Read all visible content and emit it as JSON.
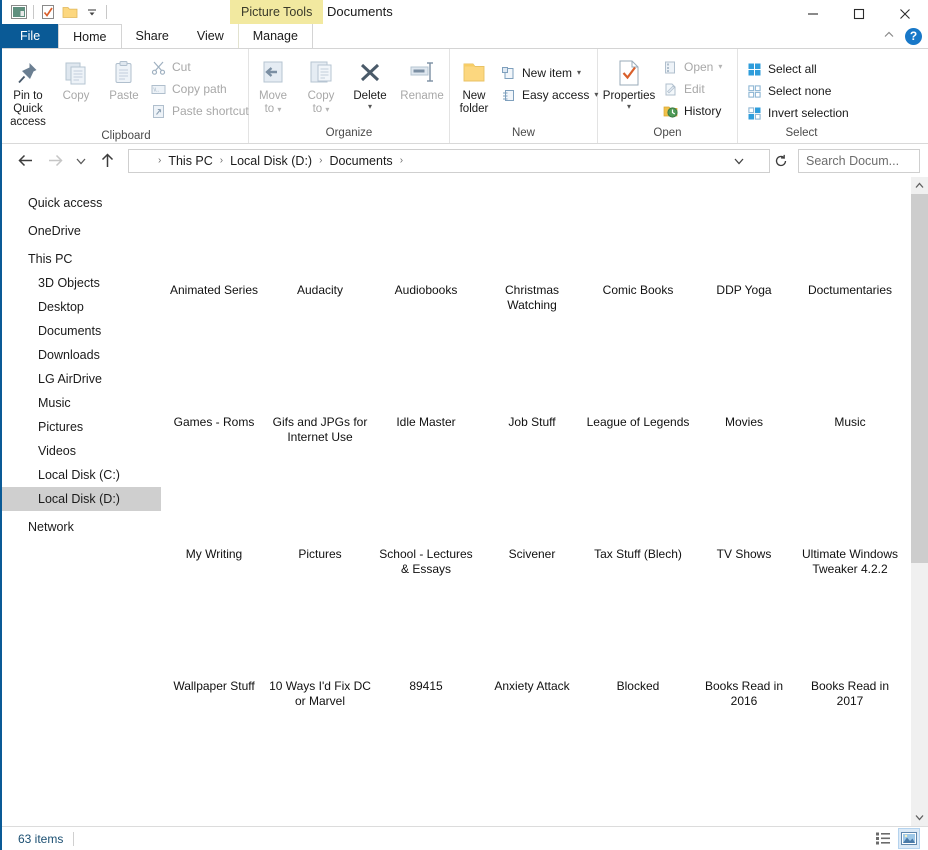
{
  "window": {
    "title": "Documents",
    "contextual_tab_title": "Picture Tools",
    "quick_access": [
      {
        "name": "explorer-icon",
        "label": "File Explorer"
      },
      {
        "name": "properties-icon",
        "label": "Properties"
      },
      {
        "name": "new-folder-icon",
        "label": "New folder"
      },
      {
        "name": "customize-qat-icon",
        "label": "Customize Quick Access Toolbar"
      }
    ],
    "controls": {
      "minimize": "—",
      "maximize": "☐",
      "close": "✕",
      "collapse_ribbon": "˄",
      "help": "?"
    }
  },
  "tabs": [
    {
      "label": "File",
      "id": "file"
    },
    {
      "label": "Home",
      "id": "home"
    },
    {
      "label": "Share",
      "id": "share"
    },
    {
      "label": "View",
      "id": "view"
    },
    {
      "label": "Manage",
      "id": "manage"
    }
  ],
  "ribbon": {
    "groups": [
      {
        "label": "Clipboard",
        "big": [
          {
            "label": "Pin to Quick\naccess",
            "line1": "Pin to Quick",
            "line2": "access",
            "icon": "pin-icon",
            "disabled": false
          },
          {
            "label": "Copy",
            "line1": "Copy",
            "line2": "",
            "icon": "copy-icon",
            "disabled": true
          },
          {
            "label": "Paste",
            "line1": "Paste",
            "line2": "",
            "icon": "paste-icon",
            "disabled": true
          }
        ],
        "small": [
          {
            "label": "Cut",
            "icon": "scissors-icon",
            "disabled": true
          },
          {
            "label": "Copy path",
            "icon": "copy-path-icon",
            "disabled": true
          },
          {
            "label": "Paste shortcut",
            "icon": "paste-shortcut-icon",
            "disabled": true
          }
        ]
      },
      {
        "label": "Organize",
        "big": [
          {
            "line1": "Move",
            "line2": "to",
            "icon": "move-to-icon",
            "disabled": true,
            "caret": true
          },
          {
            "line1": "Copy",
            "line2": "to",
            "icon": "copy-to-icon",
            "disabled": true,
            "caret": true
          },
          {
            "line1": "Delete",
            "line2": "",
            "icon": "delete-icon",
            "disabled": false,
            "caret": true
          },
          {
            "line1": "Rename",
            "line2": "",
            "icon": "rename-icon",
            "disabled": true,
            "caret": false
          }
        ],
        "small": []
      },
      {
        "label": "New",
        "big": [
          {
            "line1": "New",
            "line2": "folder",
            "icon": "new-folder-big-icon",
            "disabled": false
          }
        ],
        "small": [
          {
            "label": "New item",
            "icon": "new-item-icon",
            "disabled": false,
            "caret": true
          },
          {
            "label": "Easy access",
            "icon": "easy-access-icon",
            "disabled": false,
            "caret": true
          }
        ]
      },
      {
        "label": "Open",
        "big": [
          {
            "line1": "Properties",
            "line2": "",
            "icon": "properties-big-icon",
            "disabled": false,
            "caret": true
          }
        ],
        "small": [
          {
            "label": "Open",
            "icon": "open-icon",
            "disabled": true,
            "caret": true
          },
          {
            "label": "Edit",
            "icon": "edit-icon",
            "disabled": true
          },
          {
            "label": "History",
            "icon": "history-icon",
            "disabled": false
          }
        ]
      },
      {
        "label": "Select",
        "big": [],
        "small": [
          {
            "label": "Select all",
            "icon": "select-all-icon",
            "disabled": false
          },
          {
            "label": "Select none",
            "icon": "select-none-icon",
            "disabled": false
          },
          {
            "label": "Invert selection",
            "icon": "invert-selection-icon",
            "disabled": false
          }
        ]
      }
    ]
  },
  "address": {
    "back_icon": "back-arrow-icon",
    "forward_icon": "forward-arrow-icon",
    "recent_icon": "recent-locations-icon",
    "up_icon": "up-arrow-icon",
    "breadcrumbs": [
      "This PC",
      "Local Disk (D:)",
      "Documents"
    ],
    "separator": "›",
    "refresh_icon": "refresh-icon",
    "dropdown_icon": "chevron-down-icon"
  },
  "search": {
    "placeholder": "Search Docum...",
    "value": ""
  },
  "sidebar": {
    "items": [
      {
        "label": "Quick access",
        "level": 0,
        "selected": false,
        "gap_after": true
      },
      {
        "label": "OneDrive",
        "level": 0,
        "selected": false,
        "gap_after": true
      },
      {
        "label": "This PC",
        "level": 0,
        "selected": false,
        "gap_after": false
      },
      {
        "label": "3D Objects",
        "level": 1,
        "selected": false,
        "gap_after": false
      },
      {
        "label": "Desktop",
        "level": 1,
        "selected": false,
        "gap_after": false
      },
      {
        "label": "Documents",
        "level": 1,
        "selected": false,
        "gap_after": false
      },
      {
        "label": "Downloads",
        "level": 1,
        "selected": false,
        "gap_after": false
      },
      {
        "label": "LG AirDrive",
        "level": 1,
        "selected": false,
        "gap_after": false
      },
      {
        "label": "Music",
        "level": 1,
        "selected": false,
        "gap_after": false
      },
      {
        "label": "Pictures",
        "level": 1,
        "selected": false,
        "gap_after": false
      },
      {
        "label": "Videos",
        "level": 1,
        "selected": false,
        "gap_after": false
      },
      {
        "label": "Local Disk (C:)",
        "level": 1,
        "selected": false,
        "gap_after": false
      },
      {
        "label": "Local Disk (D:)",
        "level": 1,
        "selected": true,
        "gap_after": true
      },
      {
        "label": "Network",
        "level": 0,
        "selected": false,
        "gap_after": false
      }
    ]
  },
  "files": {
    "items": [
      {
        "name": "Animated Series"
      },
      {
        "name": "Audacity"
      },
      {
        "name": "Audiobooks"
      },
      {
        "name": "Christmas Watching"
      },
      {
        "name": "Comic Books"
      },
      {
        "name": "DDP Yoga"
      },
      {
        "name": "Doctumentaries"
      },
      {
        "name": "Games - Roms"
      },
      {
        "name": "Gifs and JPGs for Internet Use"
      },
      {
        "name": "Idle Master"
      },
      {
        "name": "Job Stuff"
      },
      {
        "name": "League of Legends"
      },
      {
        "name": "Movies"
      },
      {
        "name": "Music"
      },
      {
        "name": "My Writing"
      },
      {
        "name": "Pictures"
      },
      {
        "name": "School - Lectures & Essays"
      },
      {
        "name": "Scivener"
      },
      {
        "name": "Tax Stuff (Blech)"
      },
      {
        "name": "TV Shows"
      },
      {
        "name": "Ultimate Windows Tweaker 4.2.2"
      },
      {
        "name": "Wallpaper Stuff"
      },
      {
        "name": "10 Ways I'd Fix DC or Marvel"
      },
      {
        "name": "89415"
      },
      {
        "name": "Anxiety Attack"
      },
      {
        "name": "Blocked"
      },
      {
        "name": "Books Read in 2016"
      },
      {
        "name": "Books Read in 2017"
      }
    ]
  },
  "status": {
    "item_count": "63 items",
    "view_details_icon": "details-view-icon",
    "view_large_icons_icon": "large-icons-view-icon",
    "active_view": "large-icons"
  },
  "colors": {
    "accent": "#0a5a96",
    "contextual_tab": "#f2e9a0",
    "selection": "#cfcfcf",
    "status_text": "#1b4f72",
    "folder_yellow": "#fcd77f"
  }
}
